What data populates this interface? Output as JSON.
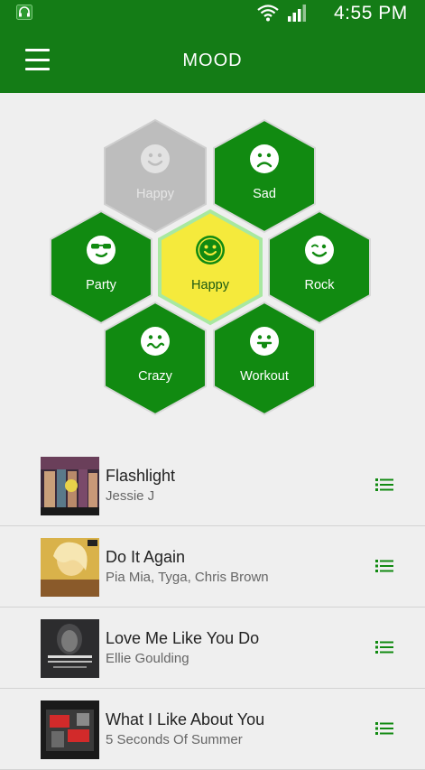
{
  "status_bar": {
    "time": "4:55 PM"
  },
  "app_bar": {
    "title": "MOOD"
  },
  "moods": [
    {
      "label": "Happy",
      "state": "disabled",
      "icon": "smile-icon"
    },
    {
      "label": "Sad",
      "state": "normal",
      "icon": "sad-icon"
    },
    {
      "label": "Party",
      "state": "normal",
      "icon": "sunglasses-icon"
    },
    {
      "label": "Happy",
      "state": "selected",
      "icon": "smile-icon"
    },
    {
      "label": "Rock",
      "state": "normal",
      "icon": "wink-icon"
    },
    {
      "label": "Crazy",
      "state": "normal",
      "icon": "crazy-face-icon"
    },
    {
      "label": "Workout",
      "state": "normal",
      "icon": "tongue-out-icon"
    }
  ],
  "songs": [
    {
      "title": "Flashlight",
      "artist": "Jessie J"
    },
    {
      "title": "Do It Again",
      "artist": "Pia Mia, Tyga, Chris Brown"
    },
    {
      "title": "Love Me Like You Do",
      "artist": "Ellie Goulding"
    },
    {
      "title": "What I Like About You",
      "artist": "5 Seconds Of Summer"
    }
  ],
  "colors": {
    "primary": "#147c16",
    "hex_green": "#118a11",
    "hex_disabled": "#bdbdbd",
    "hex_selected": "#f5ea3c",
    "selected_glow": "#a8e8a0",
    "background": "#efefef"
  }
}
